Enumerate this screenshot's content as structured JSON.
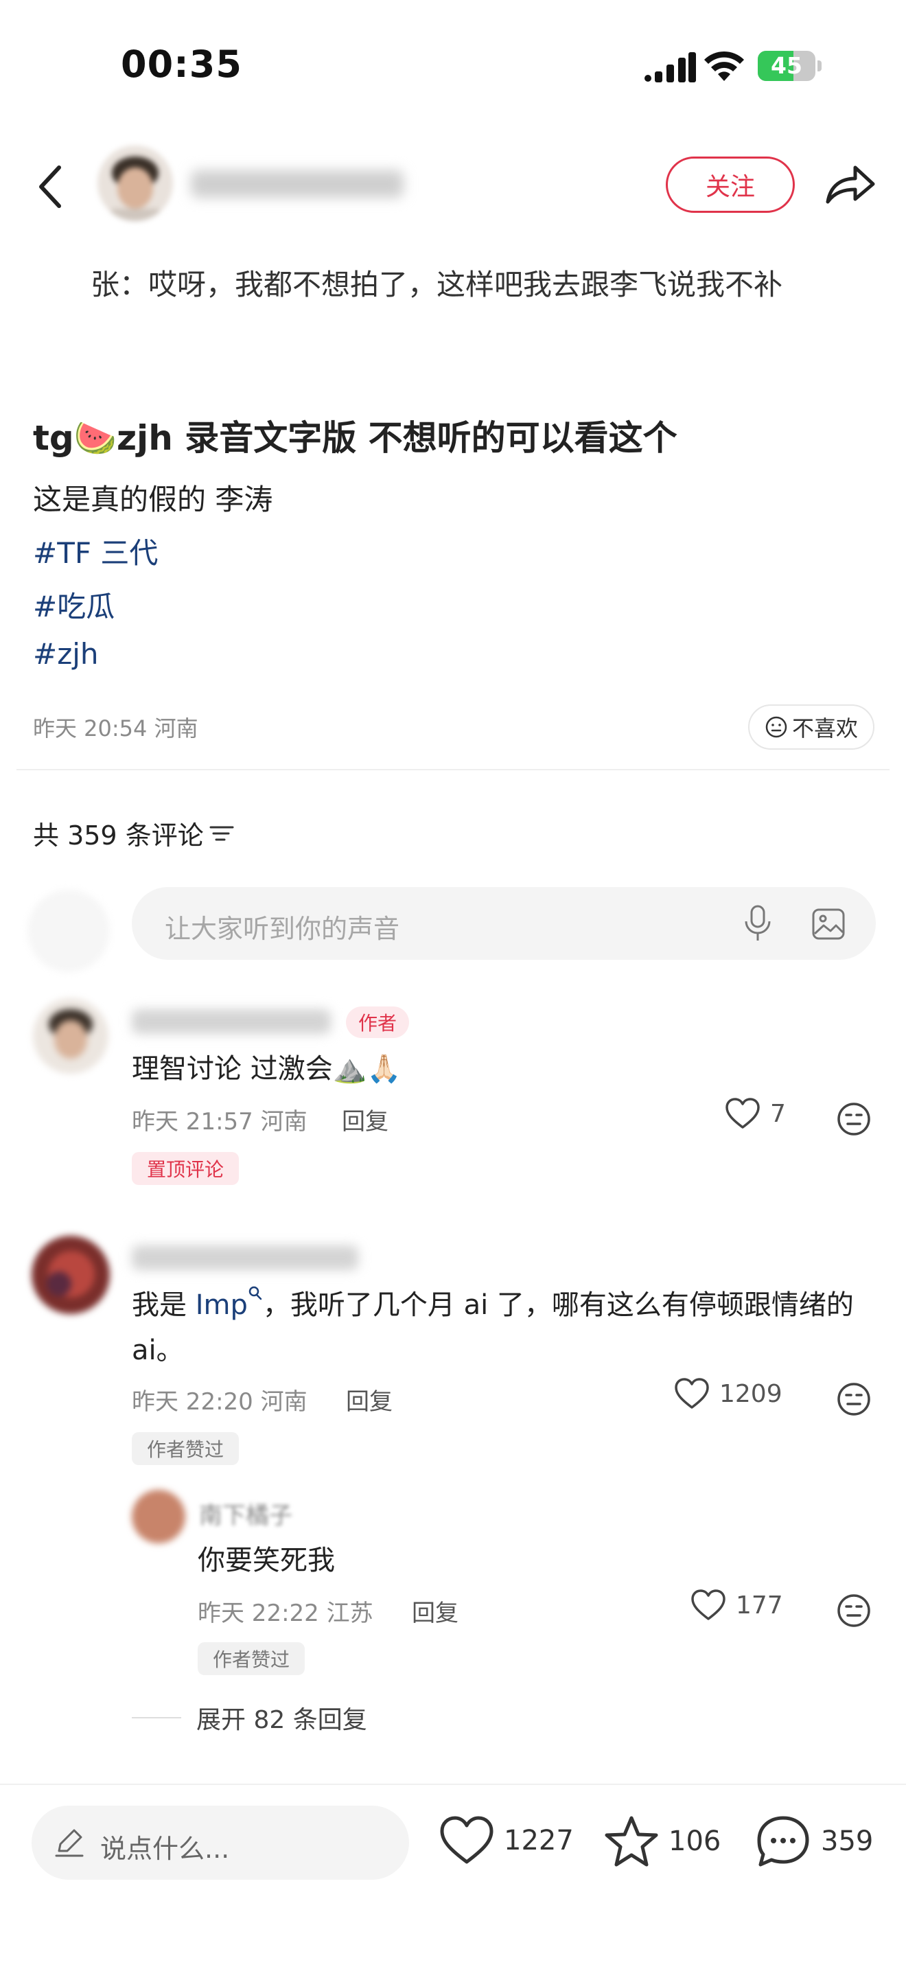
{
  "status_bar": {
    "time": "00:35",
    "battery": "45"
  },
  "header": {
    "follow_label": "关注"
  },
  "post": {
    "quote": "张：哎呀，我都不想拍了，这样吧我去跟李飞说我不补",
    "title": "tg🍉zjh 录音文字版  不想听的可以看这个",
    "description": "这是真的假的 李涛",
    "tags": [
      "#TF 三代",
      "#吃瓜",
      "#zjh"
    ],
    "meta": "昨天 20:54 河南",
    "dislike_label": "不喜欢"
  },
  "comments_section": {
    "count_label": "共 359 条评论",
    "input_placeholder": "让大家听到你的声音"
  },
  "comments": [
    {
      "badge": "作者",
      "text": "理智讨论 过激会⛰️🙏🏻",
      "meta": "昨天 21:57 河南",
      "reply_label": "回复",
      "likes": "7",
      "tag": "置顶评论"
    },
    {
      "text_prefix": "我是 ",
      "link": "Imp",
      "text_suffix": "，我听了几个月 ai 了，哪有这么有停顿跟情绪的 ai。",
      "meta": "昨天 22:20 河南",
      "reply_label": "回复",
      "likes": "1209",
      "tag": "作者赞过"
    }
  ],
  "reply": {
    "name": "南下橘子",
    "text": "你要笑死我",
    "meta": "昨天 22:22 江苏",
    "reply_label": "回复",
    "likes": "177",
    "tag": "作者赞过"
  },
  "expand_label": "展开 82 条回复",
  "bottom_bar": {
    "input_placeholder": "说点什么...",
    "likes": "1227",
    "favorites": "106",
    "comments": "359"
  },
  "colors": {
    "accent_red": "#e0334a",
    "link_blue": "#1b3f79",
    "battery_green": "#35c759"
  }
}
